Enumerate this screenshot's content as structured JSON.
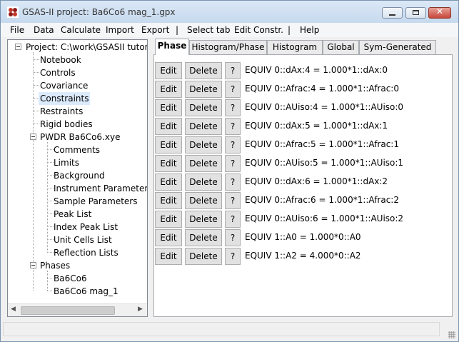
{
  "window": {
    "title": "GSAS-II project: Ba6Co6 mag_1.gpx",
    "minimize_glyph": "",
    "close_glyph": "✕"
  },
  "menu": [
    "File",
    "Data",
    "Calculate",
    "Import",
    "Export",
    "|",
    "Select tab",
    "Edit Constr.",
    "|",
    "Help"
  ],
  "tree": {
    "items": [
      {
        "label": "Project: C:\\work\\GSASII tutorials",
        "icon": "collapse-icon"
      },
      {
        "label": "Notebook"
      },
      {
        "label": "Controls"
      },
      {
        "label": "Covariance"
      },
      {
        "label": "Constraints",
        "selected": true
      },
      {
        "label": "Restraints"
      },
      {
        "label": "Rigid bodies"
      },
      {
        "label": "PWDR Ba6Co6.xye",
        "icon": "collapse-icon"
      },
      {
        "label": "Comments"
      },
      {
        "label": "Limits"
      },
      {
        "label": "Background"
      },
      {
        "label": "Instrument Parameters"
      },
      {
        "label": "Sample Parameters"
      },
      {
        "label": "Peak List"
      },
      {
        "label": "Index Peak List"
      },
      {
        "label": "Unit Cells List"
      },
      {
        "label": "Reflection Lists"
      },
      {
        "label": "Phases",
        "icon": "collapse-icon"
      },
      {
        "label": "Ba6Co6"
      },
      {
        "label": "Ba6Co6 mag_1"
      }
    ],
    "scroll_left_glyph": "◀",
    "scroll_right_glyph": "▶"
  },
  "tabs": [
    {
      "label": "Phase",
      "active": true
    },
    {
      "label": "Histogram/Phase"
    },
    {
      "label": "Histogram"
    },
    {
      "label": "Global"
    },
    {
      "label": "Sym-Generated"
    }
  ],
  "constraints": {
    "edit_label": "Edit",
    "delete_label": "Delete",
    "help_label": "?",
    "rows": [
      "EQUIV 0::dAx:4  = 1.000*1::dAx:0",
      "EQUIV 0::Afrac:4  = 1.000*1::Afrac:0",
      "EQUIV 0::AUiso:4  = 1.000*1::AUiso:0",
      "EQUIV 0::dAx:5  = 1.000*1::dAx:1",
      "EQUIV 0::Afrac:5  = 1.000*1::Afrac:1",
      "EQUIV 0::AUiso:5  = 1.000*1::AUiso:1",
      "EQUIV 0::dAx:6  = 1.000*1::dAx:2",
      "EQUIV 0::Afrac:6  = 1.000*1::Afrac:2",
      "EQUIV 0::AUiso:6  = 1.000*1::AUiso:2",
      "EQUIV 1::A0  = 1.000*0::A0",
      "EQUIV 1::A2  = 4.000*0::A2"
    ]
  },
  "colors": {
    "selection": "#dcebfc",
    "titlebar": "#c6d9ee",
    "close_button": "#c7473a"
  }
}
